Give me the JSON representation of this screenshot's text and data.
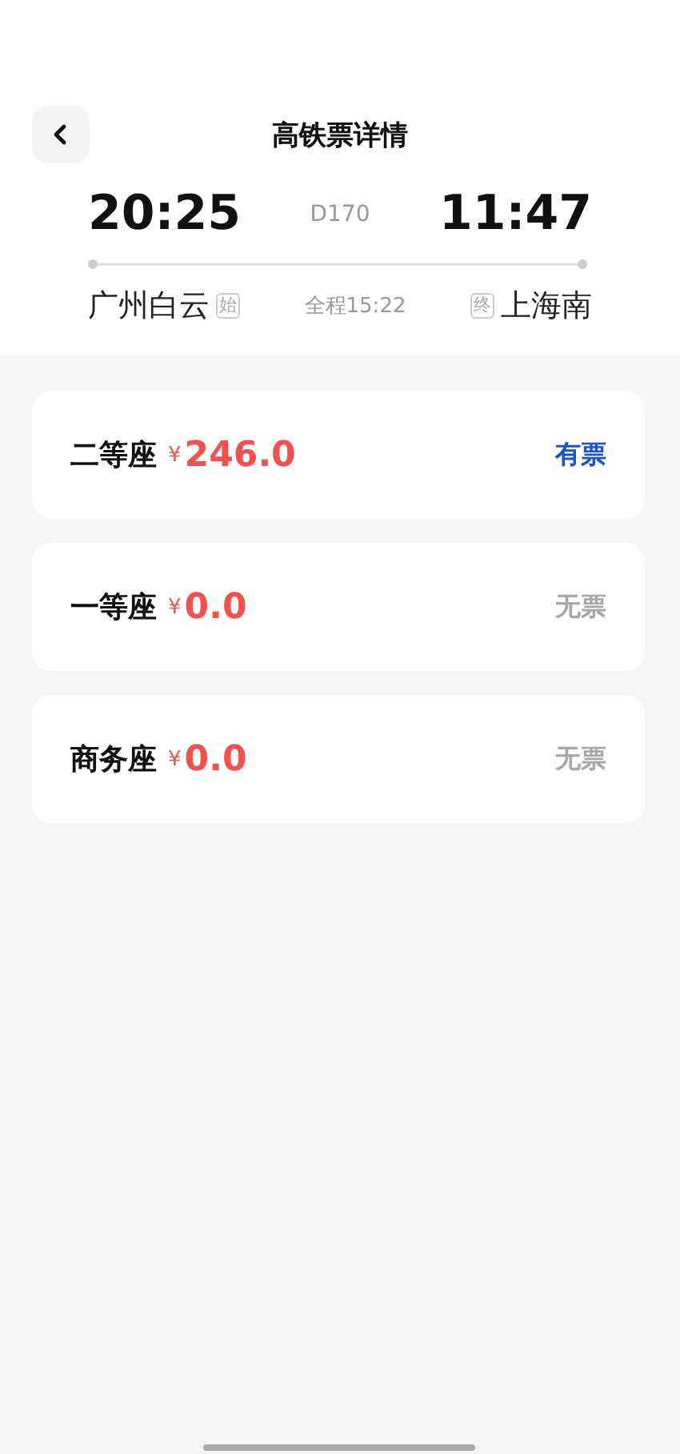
{
  "header": {
    "title": "高铁票详情"
  },
  "trip": {
    "depart_time": "20:25",
    "train_no": "D170",
    "arrive_time": "11:47",
    "from_station": "广州白云",
    "from_tag": "始",
    "duration": "全程15:22",
    "to_tag": "终",
    "to_station": "上海南"
  },
  "seats": [
    {
      "name": "二等座",
      "currency": "¥",
      "price": "246.0",
      "status": "有票",
      "available": true
    },
    {
      "name": "一等座",
      "currency": "¥",
      "price": "0.0",
      "status": "无票",
      "available": false
    },
    {
      "name": "商务座",
      "currency": "¥",
      "price": "0.0",
      "status": "无票",
      "available": false
    }
  ]
}
